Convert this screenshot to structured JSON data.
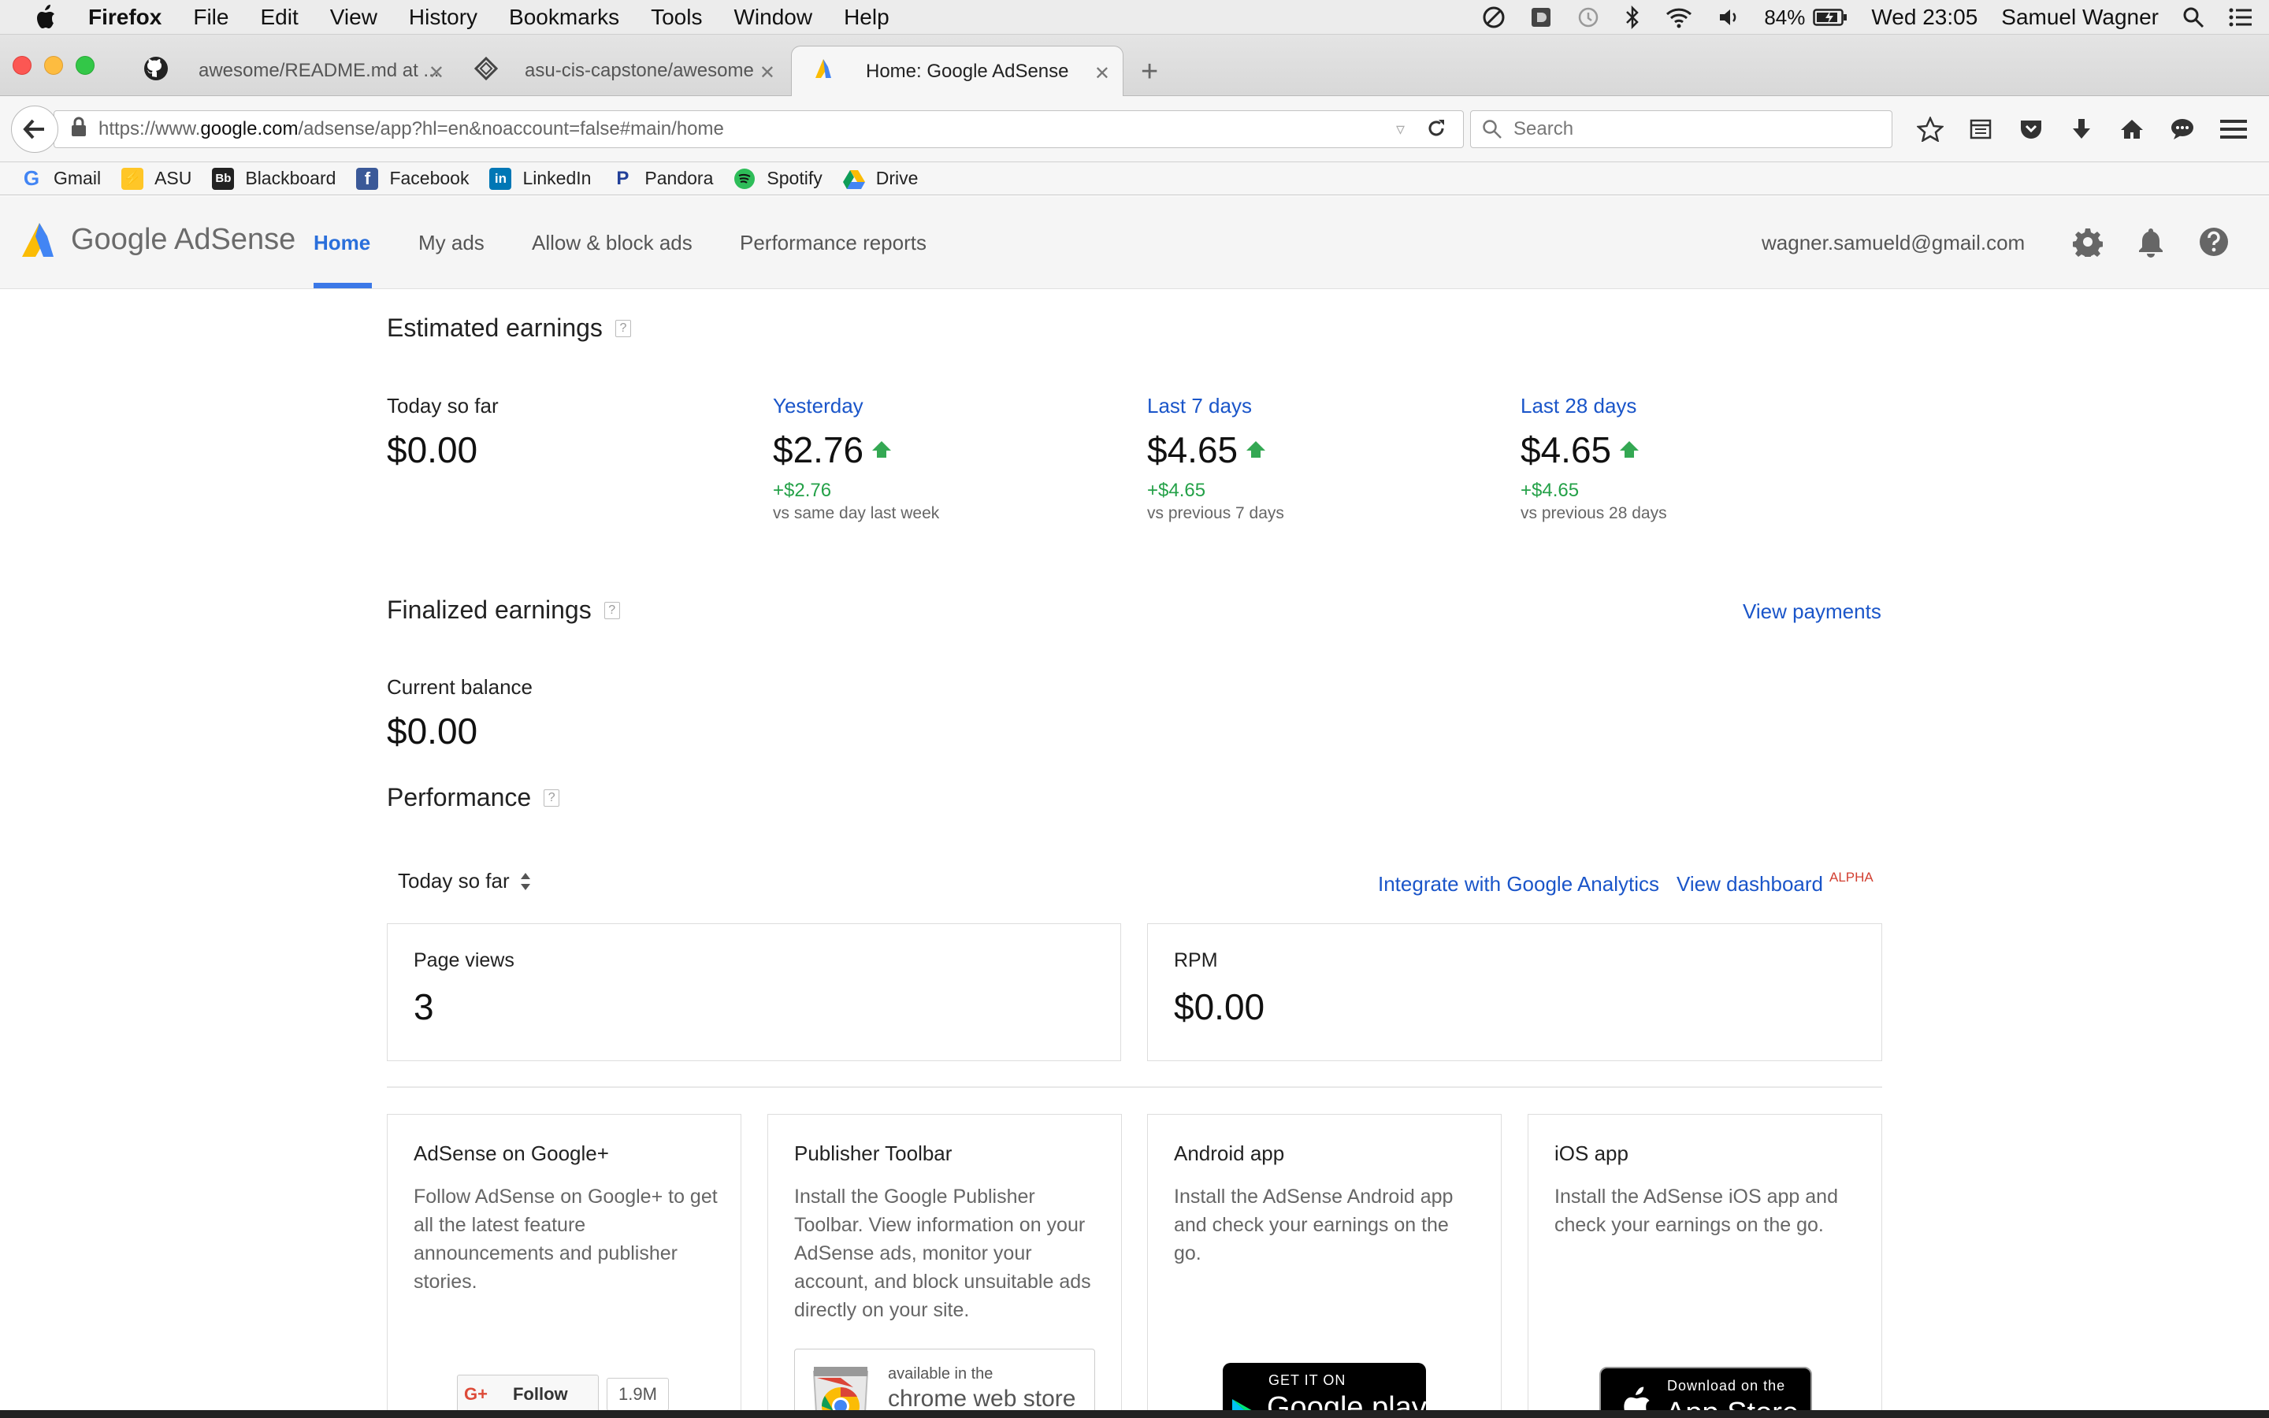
{
  "menubar": {
    "app_name": "Firefox",
    "menus": [
      "File",
      "Edit",
      "View",
      "History",
      "Bookmarks",
      "Tools",
      "Window",
      "Help"
    ],
    "battery": "84%",
    "clock": "Wed 23:05",
    "user": "Samuel Wagner"
  },
  "browser": {
    "tabs": [
      {
        "title": "awesome/README.md at ...",
        "icon": "github-icon",
        "active": false
      },
      {
        "title": "asu-cis-capstone/awesome",
        "icon": "repo-icon",
        "active": false
      },
      {
        "title": "Home: Google AdSense",
        "icon": "adsense-icon",
        "active": true
      }
    ],
    "url_prefix": "https://www.",
    "url_host": "google.com",
    "url_path": "/adsense/app?hl=en&noaccount=false#main/home",
    "search_placeholder": "Search",
    "bookmarks": [
      {
        "label": "Gmail",
        "icon": "google-icon"
      },
      {
        "label": "ASU",
        "icon": "asu-icon"
      },
      {
        "label": "Blackboard",
        "icon": "blackboard-icon"
      },
      {
        "label": "Facebook",
        "icon": "facebook-icon"
      },
      {
        "label": "LinkedIn",
        "icon": "linkedin-icon"
      },
      {
        "label": "Pandora",
        "icon": "pandora-icon"
      },
      {
        "label": "Spotify",
        "icon": "spotify-icon"
      },
      {
        "label": "Drive",
        "icon": "drive-icon"
      }
    ]
  },
  "app": {
    "logo_text": "Google AdSense",
    "nav": [
      "Home",
      "My ads",
      "Allow & block ads",
      "Performance reports"
    ],
    "active_nav": "Home",
    "account_email": "wagner.samueld@gmail.com"
  },
  "estimated": {
    "title": "Estimated earnings",
    "help": "?",
    "metrics": [
      {
        "label": "Today so far",
        "value": "$0.00",
        "delta": "",
        "compare": ""
      },
      {
        "label": "Yesterday",
        "value": "$2.76",
        "delta": "+$2.76",
        "compare": "vs same day last week"
      },
      {
        "label": "Last 7 days",
        "value": "$4.65",
        "delta": "+$4.65",
        "compare": "vs previous 7 days"
      },
      {
        "label": "Last 28 days",
        "value": "$4.65",
        "delta": "+$4.65",
        "compare": "vs previous 28 days"
      }
    ]
  },
  "finalized": {
    "title": "Finalized earnings",
    "help": "?",
    "view_payments": "View payments",
    "balance_label": "Current balance",
    "balance_value": "$0.00"
  },
  "performance": {
    "title": "Performance",
    "help": "?",
    "range": "Today so far",
    "integrate_link": "Integrate with Google Analytics",
    "dashboard_link": "View dashboard",
    "alpha_badge": "ALPHA",
    "cards": [
      {
        "label": "Page views",
        "value": "3"
      },
      {
        "label": "RPM",
        "value": "$0.00"
      }
    ]
  },
  "promos": [
    {
      "title": "AdSense on Google+",
      "desc": "Follow AdSense on Google+ to get all the latest feature announcements and publisher stories.",
      "follow_label": "Follow",
      "follower_count": "1.9M",
      "gplus_icon": "G+"
    },
    {
      "title": "Publisher Toolbar",
      "desc": "Install the Google Publisher Toolbar. View information on your AdSense ads, monitor your account, and block unsuitable ads directly on your site.",
      "badge_small": "available in the",
      "badge_big": "chrome web store"
    },
    {
      "title": "Android app",
      "desc": "Install the AdSense Android app and check your earnings on the go.",
      "badge_small": "GET IT ON",
      "badge_big": "Google play"
    },
    {
      "title": "iOS app",
      "desc": "Install the AdSense iOS app and check your earnings on the go.",
      "badge_small": "Download on the",
      "badge_big": "App Store"
    }
  ],
  "colors": {
    "accent": "#3b78e7",
    "link": "#1a55c9",
    "positive": "#24a148",
    "alpha": "#d23f31"
  }
}
